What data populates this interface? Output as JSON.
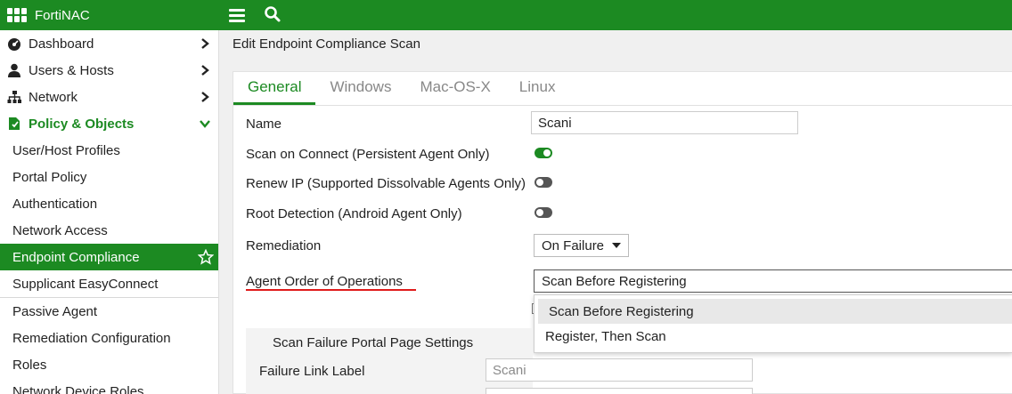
{
  "app": {
    "name": "FortiNAC"
  },
  "topbar": {
    "menu_icon": "hamburger-menu-icon",
    "search_icon": "search-icon"
  },
  "sidebar": {
    "top_items": [
      {
        "label": "Dashboard",
        "icon": "dashboard-icon"
      },
      {
        "label": "Users & Hosts",
        "icon": "user-icon"
      },
      {
        "label": "Network",
        "icon": "network-icon"
      },
      {
        "label": "Policy & Objects",
        "icon": "policy-icon",
        "expanded": true
      }
    ],
    "sub_items": [
      {
        "label": "User/Host Profiles"
      },
      {
        "label": "Portal Policy"
      },
      {
        "label": "Authentication"
      },
      {
        "label": "Network Access"
      },
      {
        "label": "Endpoint Compliance",
        "active": true
      },
      {
        "label": "Supplicant EasyConnect"
      },
      {
        "label": "Passive Agent"
      },
      {
        "label": "Remediation Configuration"
      },
      {
        "label": "Roles"
      },
      {
        "label": "Network Device Roles"
      }
    ]
  },
  "page": {
    "title": "Edit Endpoint Compliance Scan"
  },
  "tabs": [
    {
      "label": "General",
      "active": true
    },
    {
      "label": "Windows"
    },
    {
      "label": "Mac-OS-X"
    },
    {
      "label": "Linux"
    }
  ],
  "form": {
    "name_label": "Name",
    "name_value": "Scani",
    "scan_on_connect_label": "Scan on Connect (Persistent Agent Only)",
    "scan_on_connect": true,
    "renew_ip_label": "Renew IP (Supported Dissolvable Agents Only)",
    "renew_ip": false,
    "root_detection_label": "Root Detection (Android Agent Only)",
    "root_detection": false,
    "remediation_label": "Remediation",
    "remediation_value": "On Failure",
    "agent_order_label": "Agent Order of Operations",
    "agent_order_value": "Scan Before Registering",
    "agent_order_options": [
      "Scan Before Registering",
      "Register, Then Scan"
    ],
    "scan_failure_section_title": "Scan Failure Portal Page Settings",
    "failure_link_label": "Failure Link Label",
    "failure_link_placeholder": "Scani"
  },
  "colors": {
    "brand_green": "#1c8a22",
    "highlight_red": "#e01b1b"
  }
}
